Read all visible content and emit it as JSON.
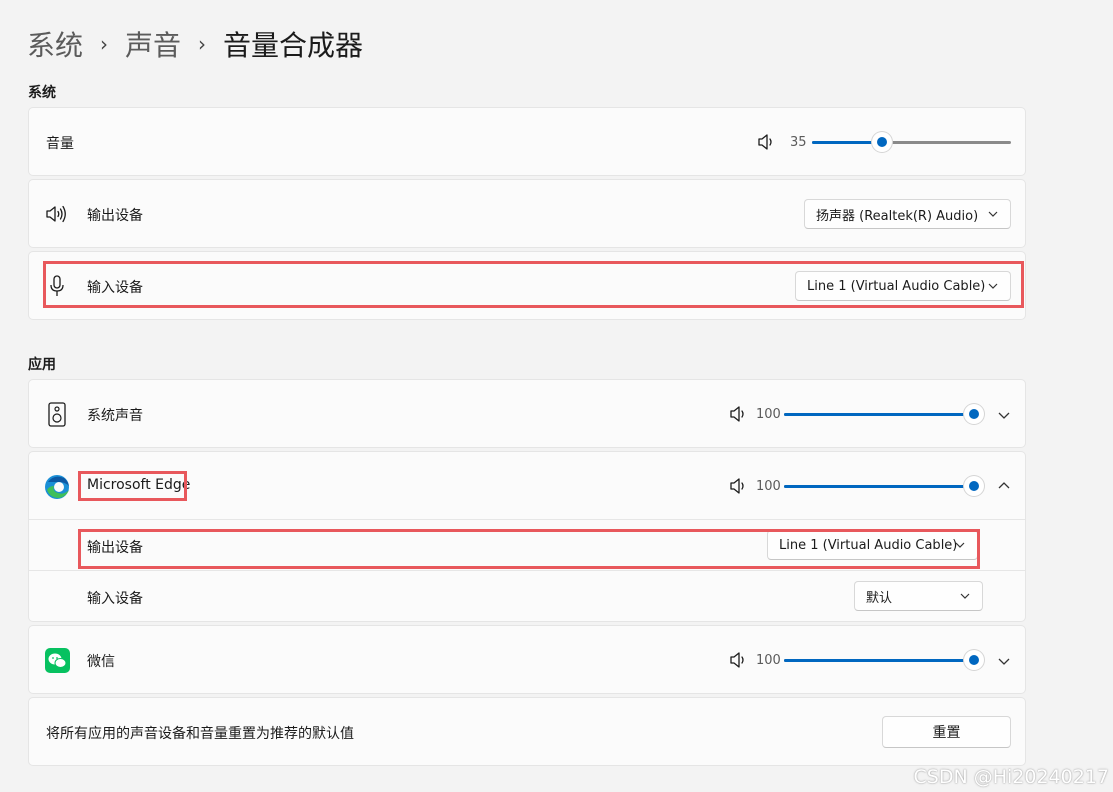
{
  "breadcrumb": {
    "items": [
      "系统",
      "声音"
    ],
    "current": "音量合成器",
    "separator": "›"
  },
  "system_section": {
    "title": "系统",
    "volume": {
      "label": "音量",
      "value": "35",
      "level": 0.35,
      "icon": "speaker-icon"
    },
    "output_device": {
      "label": "输出设备",
      "value": "扬声器 (Realtek(R) Audio)",
      "icon": "speaker-waves-icon"
    },
    "input_device": {
      "label": "输入设备",
      "value": "Line 1 (Virtual Audio Cable)",
      "icon": "microphone-icon"
    }
  },
  "apps_section": {
    "title": "应用",
    "system_sounds": {
      "label": "系统声音",
      "volume": "100",
      "level": 1.0,
      "icon": "speaker-box-icon"
    },
    "edge": {
      "label": "Microsoft Edge",
      "volume": "100",
      "level": 1.0,
      "icon": "edge-icon",
      "output_label": "输出设备",
      "output_value": "Line 1 (Virtual Audio Cable)",
      "input_label": "输入设备",
      "input_value": "默认"
    },
    "wechat": {
      "label": "微信",
      "volume": "100",
      "level": 1.0,
      "icon": "wechat-icon"
    }
  },
  "reset": {
    "text": "将所有应用的声音设备和音量重置为推荐的默认值",
    "button": "重置"
  },
  "watermark": "CSDN @Hi20240217",
  "colors": {
    "accent": "#0067c0",
    "highlight": "#e8585c",
    "background": "#f3f3f3",
    "card": "#fbfbfb"
  }
}
